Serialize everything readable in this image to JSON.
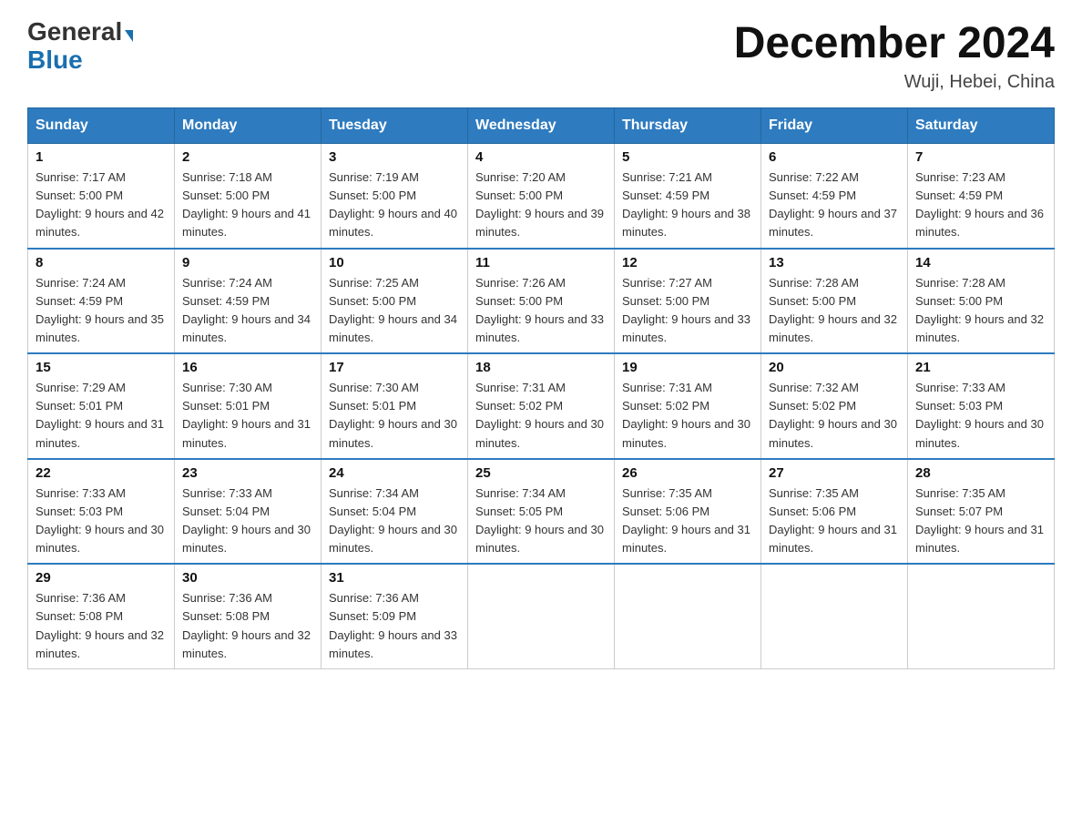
{
  "header": {
    "logo_general": "General",
    "logo_blue": "Blue",
    "month_title": "December 2024",
    "location": "Wuji, Hebei, China"
  },
  "weekdays": [
    "Sunday",
    "Monday",
    "Tuesday",
    "Wednesday",
    "Thursday",
    "Friday",
    "Saturday"
  ],
  "weeks": [
    [
      {
        "day": "1",
        "sunrise": "7:17 AM",
        "sunset": "5:00 PM",
        "daylight": "9 hours and 42 minutes."
      },
      {
        "day": "2",
        "sunrise": "7:18 AM",
        "sunset": "5:00 PM",
        "daylight": "9 hours and 41 minutes."
      },
      {
        "day": "3",
        "sunrise": "7:19 AM",
        "sunset": "5:00 PM",
        "daylight": "9 hours and 40 minutes."
      },
      {
        "day": "4",
        "sunrise": "7:20 AM",
        "sunset": "5:00 PM",
        "daylight": "9 hours and 39 minutes."
      },
      {
        "day": "5",
        "sunrise": "7:21 AM",
        "sunset": "4:59 PM",
        "daylight": "9 hours and 38 minutes."
      },
      {
        "day": "6",
        "sunrise": "7:22 AM",
        "sunset": "4:59 PM",
        "daylight": "9 hours and 37 minutes."
      },
      {
        "day": "7",
        "sunrise": "7:23 AM",
        "sunset": "4:59 PM",
        "daylight": "9 hours and 36 minutes."
      }
    ],
    [
      {
        "day": "8",
        "sunrise": "7:24 AM",
        "sunset": "4:59 PM",
        "daylight": "9 hours and 35 minutes."
      },
      {
        "day": "9",
        "sunrise": "7:24 AM",
        "sunset": "4:59 PM",
        "daylight": "9 hours and 34 minutes."
      },
      {
        "day": "10",
        "sunrise": "7:25 AM",
        "sunset": "5:00 PM",
        "daylight": "9 hours and 34 minutes."
      },
      {
        "day": "11",
        "sunrise": "7:26 AM",
        "sunset": "5:00 PM",
        "daylight": "9 hours and 33 minutes."
      },
      {
        "day": "12",
        "sunrise": "7:27 AM",
        "sunset": "5:00 PM",
        "daylight": "9 hours and 33 minutes."
      },
      {
        "day": "13",
        "sunrise": "7:28 AM",
        "sunset": "5:00 PM",
        "daylight": "9 hours and 32 minutes."
      },
      {
        "day": "14",
        "sunrise": "7:28 AM",
        "sunset": "5:00 PM",
        "daylight": "9 hours and 32 minutes."
      }
    ],
    [
      {
        "day": "15",
        "sunrise": "7:29 AM",
        "sunset": "5:01 PM",
        "daylight": "9 hours and 31 minutes."
      },
      {
        "day": "16",
        "sunrise": "7:30 AM",
        "sunset": "5:01 PM",
        "daylight": "9 hours and 31 minutes."
      },
      {
        "day": "17",
        "sunrise": "7:30 AM",
        "sunset": "5:01 PM",
        "daylight": "9 hours and 30 minutes."
      },
      {
        "day": "18",
        "sunrise": "7:31 AM",
        "sunset": "5:02 PM",
        "daylight": "9 hours and 30 minutes."
      },
      {
        "day": "19",
        "sunrise": "7:31 AM",
        "sunset": "5:02 PM",
        "daylight": "9 hours and 30 minutes."
      },
      {
        "day": "20",
        "sunrise": "7:32 AM",
        "sunset": "5:02 PM",
        "daylight": "9 hours and 30 minutes."
      },
      {
        "day": "21",
        "sunrise": "7:33 AM",
        "sunset": "5:03 PM",
        "daylight": "9 hours and 30 minutes."
      }
    ],
    [
      {
        "day": "22",
        "sunrise": "7:33 AM",
        "sunset": "5:03 PM",
        "daylight": "9 hours and 30 minutes."
      },
      {
        "day": "23",
        "sunrise": "7:33 AM",
        "sunset": "5:04 PM",
        "daylight": "9 hours and 30 minutes."
      },
      {
        "day": "24",
        "sunrise": "7:34 AM",
        "sunset": "5:04 PM",
        "daylight": "9 hours and 30 minutes."
      },
      {
        "day": "25",
        "sunrise": "7:34 AM",
        "sunset": "5:05 PM",
        "daylight": "9 hours and 30 minutes."
      },
      {
        "day": "26",
        "sunrise": "7:35 AM",
        "sunset": "5:06 PM",
        "daylight": "9 hours and 31 minutes."
      },
      {
        "day": "27",
        "sunrise": "7:35 AM",
        "sunset": "5:06 PM",
        "daylight": "9 hours and 31 minutes."
      },
      {
        "day": "28",
        "sunrise": "7:35 AM",
        "sunset": "5:07 PM",
        "daylight": "9 hours and 31 minutes."
      }
    ],
    [
      {
        "day": "29",
        "sunrise": "7:36 AM",
        "sunset": "5:08 PM",
        "daylight": "9 hours and 32 minutes."
      },
      {
        "day": "30",
        "sunrise": "7:36 AM",
        "sunset": "5:08 PM",
        "daylight": "9 hours and 32 minutes."
      },
      {
        "day": "31",
        "sunrise": "7:36 AM",
        "sunset": "5:09 PM",
        "daylight": "9 hours and 33 minutes."
      },
      null,
      null,
      null,
      null
    ]
  ]
}
